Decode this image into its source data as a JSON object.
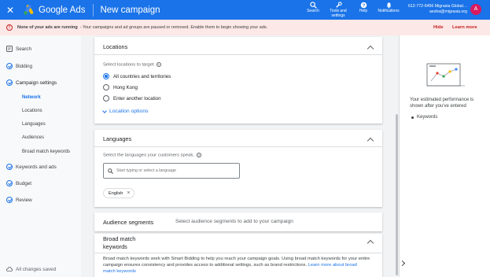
{
  "topbar": {
    "brand": "Google Ads",
    "page_title": "New campaign",
    "tools": [
      {
        "label": "Search",
        "icon": "search-icon"
      },
      {
        "label": "Tools and settings",
        "icon": "wrench-icon"
      },
      {
        "label": "Help",
        "icon": "help-icon"
      },
      {
        "label": "Notifications",
        "icon": "bell-icon"
      }
    ],
    "account_line1": "612-772-6456 Migrasia Global…",
    "account_line2": "aesha@migrasia.org",
    "avatar_letter": "A"
  },
  "alert": {
    "strong": "None of your ads are running",
    "message": "- Your campaigns and ad groups are paused or removed. Enable them to begin showing your ads.",
    "hide": "Hide",
    "learn_more": "Learn more"
  },
  "sidebar": {
    "items": [
      {
        "label": "Search"
      },
      {
        "label": "Bidding"
      },
      {
        "label": "Campaign settings"
      },
      {
        "label": "Keywords and ads"
      },
      {
        "label": "Budget"
      },
      {
        "label": "Review"
      }
    ],
    "subitems": [
      {
        "label": "Network"
      },
      {
        "label": "Locations"
      },
      {
        "label": "Languages"
      },
      {
        "label": "Audiences"
      },
      {
        "label": "Broad match keywords"
      }
    ],
    "saved": "All changes saved"
  },
  "locations": {
    "title": "Locations",
    "prompt": "Select locations to target",
    "options": [
      "All countries and territories",
      "Hong Kong",
      "Enter another location"
    ],
    "selected_index": 0,
    "more": "Location options"
  },
  "languages": {
    "title": "Languages",
    "prompt": "Select the languages your customers speak.",
    "search_placeholder": "Start typing or select a language",
    "chips": [
      "English"
    ]
  },
  "audience": {
    "title": "Audience segments",
    "desc": "Select audience segments to add to your campaign"
  },
  "broad_match": {
    "title_line1": "Broad match",
    "title_line2": "keywords",
    "desc": "Broad match keywords work with Smart Bidding to help you reach your campaign goals. Using broad match keywords for your entire campaign ensures consistency and provides access to additional settings, such as brand restrictions.",
    "link": "Learn more about broad match keywords"
  },
  "right_panel": {
    "text": "Your estimated performance is shown after you've entered",
    "bullet": "Keywords"
  },
  "colors": {
    "primary": "#1a73e8",
    "alert_bg": "#fce8e6",
    "alert_text": "#c5221f",
    "avatar": "#d81b60"
  }
}
